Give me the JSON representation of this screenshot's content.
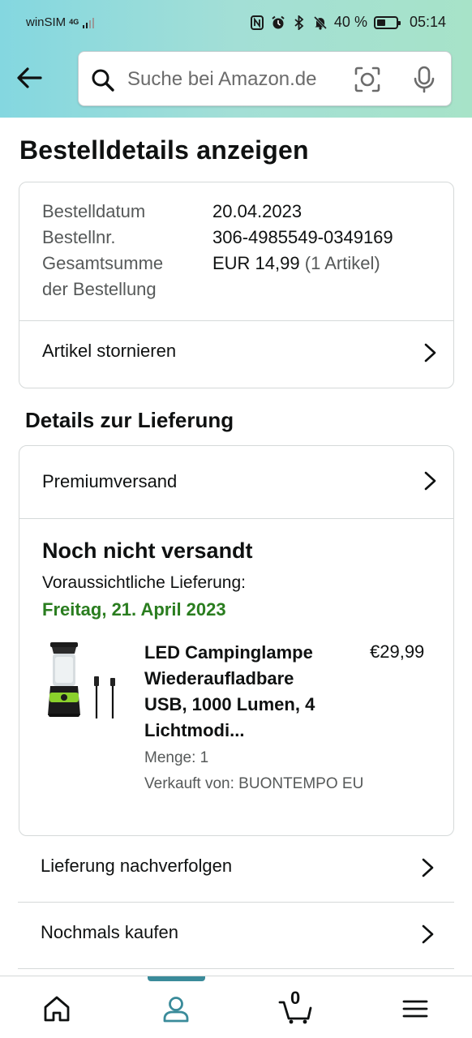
{
  "status_bar": {
    "carrier": "winSIM",
    "network": "4G",
    "battery_percent": "40 %",
    "time": "05:14"
  },
  "search": {
    "placeholder": "Suche bei Amazon.de"
  },
  "page_title": "Bestelldetails anzeigen",
  "order": {
    "date_label": "Bestelldatum",
    "date_value": "20.04.2023",
    "number_label": "Bestellnr.",
    "number_value": "306-4985549-0349169",
    "total_label_line1": "Gesamtsumme",
    "total_label_line2": "der Bestellung",
    "total_value": "EUR 14,99",
    "total_items": "(1 Artikel)",
    "cancel_label": "Artikel stornieren"
  },
  "delivery": {
    "section_title": "Details zur Lieferung",
    "shipping_method": "Premiumversand",
    "status": "Noch nicht versandt",
    "expected_label": "Voraussichtliche Lieferung:",
    "expected_date": "Freitag, 21. April 2023",
    "product": {
      "title_lines": [
        "LED Campinglampe",
        "Wiederaufladbare",
        "USB, 1000 Lumen, 4",
        "Lichtmodi..."
      ],
      "price": "€29,99",
      "quantity": "Menge: 1",
      "seller": "Verkauft von: BUONTEMPO EU"
    }
  },
  "actions": {
    "track": "Lieferung nachverfolgen",
    "buy_again": "Nochmals kaufen"
  },
  "bottom_nav": {
    "cart_count": "0",
    "active_tab": "account",
    "accent_color": "#3a8b9a"
  },
  "colors": {
    "delivery_green": "#2a7d1f",
    "header_gradient_start": "#84d7e0",
    "header_gradient_end": "#a7e3c8"
  }
}
